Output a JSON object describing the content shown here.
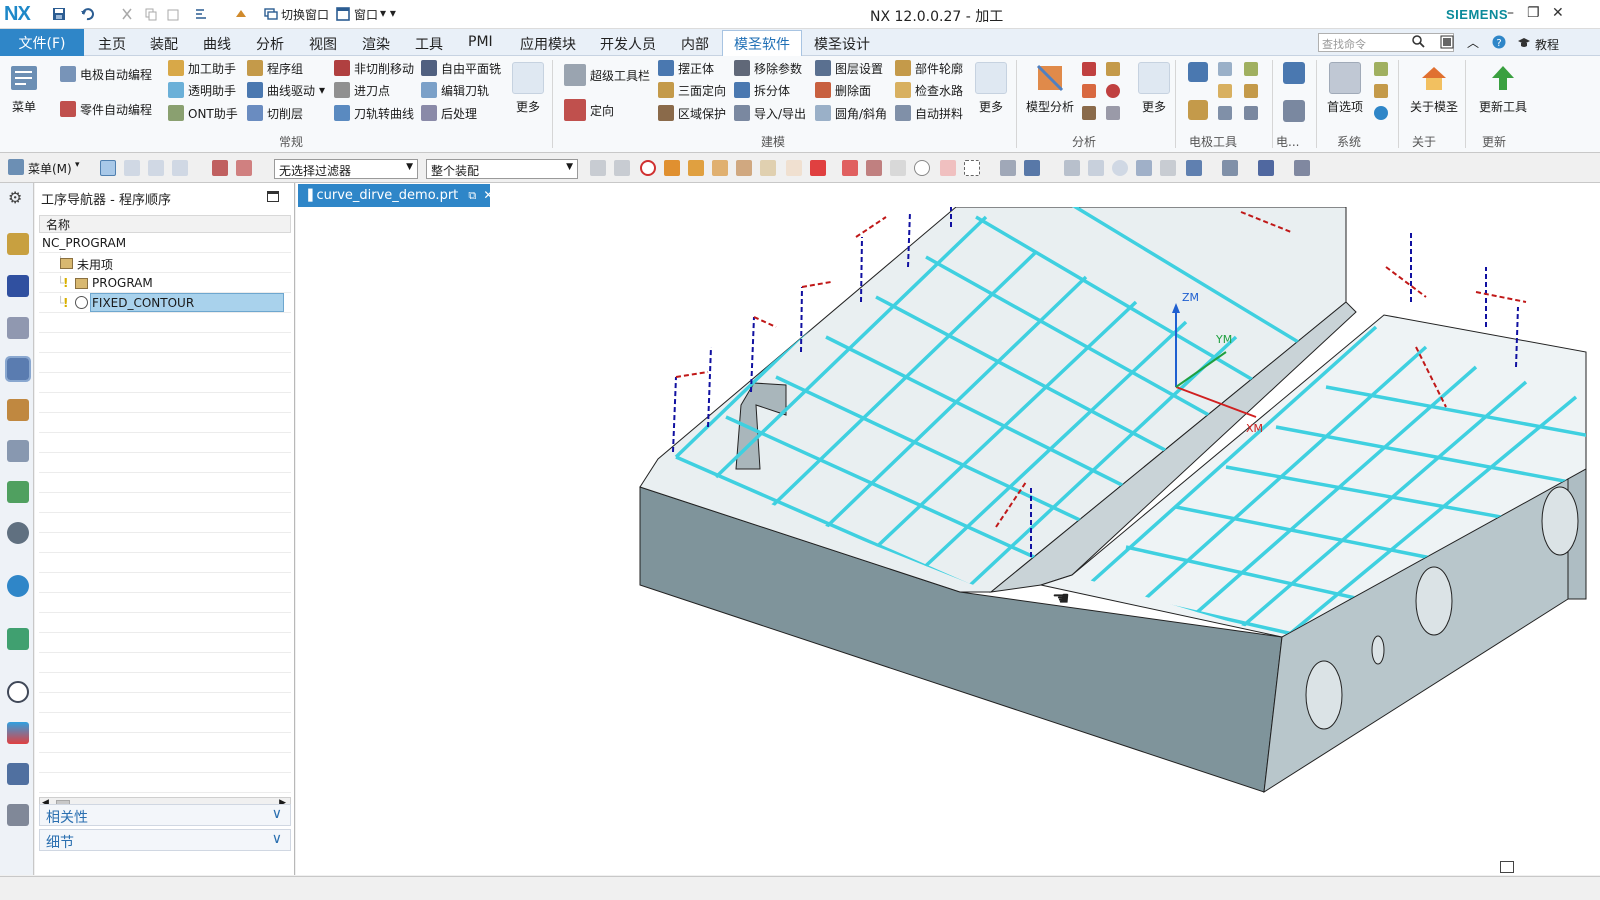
{
  "app": {
    "logo": "NX",
    "title": "NX 12.0.0.27 - 加工",
    "brand": "SIEMENS"
  },
  "quick_access": {
    "switch_window": "切换窗口",
    "window": "窗口"
  },
  "menu": {
    "file": "文件(F)",
    "tabs": [
      "主页",
      "装配",
      "曲线",
      "分析",
      "视图",
      "渲染",
      "工具",
      "PMI",
      "应用模块",
      "开发人员",
      "内部",
      "模圣软件",
      "模圣设计"
    ],
    "active_tab": "模圣软件",
    "search_placeholder": "查找命令",
    "tutorial": "教程"
  },
  "ribbon": {
    "menu_btn": "菜单",
    "electrode_auto": "电极自动编程",
    "part_auto": "零件自动编程",
    "machining_helper": "加工助手",
    "transparent_helper": "透明助手",
    "ont_helper": "ONT助手",
    "program_group": "程序组",
    "curve_drive": "曲线驱动",
    "cut_layer": "切削层",
    "non_cut_move": "非切削移动",
    "entry_point": "进刀点",
    "toolpath_to_curve": "刀轨转曲线",
    "free_plane_mill": "自由平面铣",
    "edit_toolpath": "编辑刀轨",
    "post_process": "后处理",
    "more1": "更多",
    "super_toolbar": "超级工具栏",
    "orient": "定向",
    "swing_body": "摆正体",
    "three_face": "三面定向",
    "region_protect": "区域保护",
    "remove_params": "移除参数",
    "split_body": "拆分体",
    "import_export": "导入/导出",
    "layer_setting": "图层设置",
    "delete_face": "删除面",
    "fillet_chamfer": "圆角/斜角",
    "part_outline": "部件轮廓",
    "check_waterway": "检查水路",
    "auto_stock": "自动拼料",
    "more2": "更多",
    "model_analysis": "模型分析",
    "more3": "更多",
    "preferences": "首选项",
    "about": "关于模圣",
    "update_tools": "更新工具",
    "groups": {
      "common": "常规",
      "modeling": "建模",
      "analysis": "分析",
      "electrode_tools": "电极工具",
      "elec_short": "电...",
      "system": "系统",
      "about": "关于",
      "update": "更新"
    }
  },
  "toolbar": {
    "menu": "菜单(M)",
    "filter": "无选择过滤器",
    "assembly": "整个装配"
  },
  "navigator": {
    "title": "工序导航器 - 程序顺序",
    "col_name": "名称",
    "rows": [
      "NC_PROGRAM",
      "未用项",
      "PROGRAM",
      "FIXED_CONTOUR"
    ],
    "selected_row": "FIXED_CONTOUR",
    "panels": [
      "相关性",
      "细节"
    ]
  },
  "viewport": {
    "doc_tab": "curve_dirve_demo.prt",
    "axes": {
      "z": "ZM",
      "y": "YM",
      "x": "XM"
    }
  },
  "colors": {
    "accent": "#2f86c8",
    "brand": "#0a8a9a",
    "toolpath": "#3fd0e0",
    "selected_row": "#a9d2ec"
  }
}
